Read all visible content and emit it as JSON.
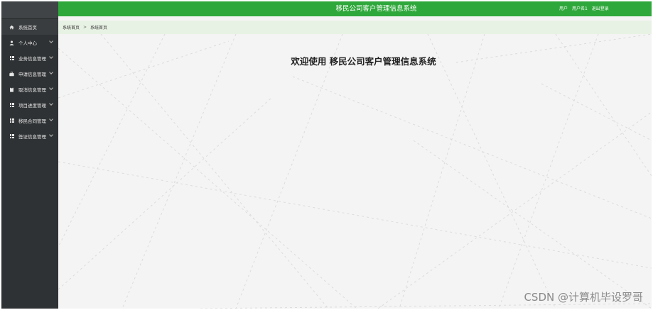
{
  "app_title": "移民公司客户管理信息系统",
  "header": {
    "user_label": "用户",
    "username": "用户名1",
    "logout_label": "退出登录"
  },
  "sidebar": {
    "items": [
      {
        "label": "系统首页",
        "icon": "home-icon",
        "active": true,
        "expandable": false
      },
      {
        "label": "个人中心",
        "icon": "user-icon",
        "active": false,
        "expandable": true
      },
      {
        "label": "业务信息管理",
        "icon": "grid-icon",
        "active": false,
        "expandable": true
      },
      {
        "label": "申请信息管理",
        "icon": "briefcase-icon",
        "active": false,
        "expandable": true
      },
      {
        "label": "取消信息管理",
        "icon": "clipboard-icon",
        "active": false,
        "expandable": true
      },
      {
        "label": "项目进度管理",
        "icon": "grid-icon",
        "active": false,
        "expandable": true
      },
      {
        "label": "移民合同管理",
        "icon": "grid-icon",
        "active": false,
        "expandable": true
      },
      {
        "label": "签证信息管理",
        "icon": "grid-icon",
        "active": false,
        "expandable": true
      }
    ]
  },
  "breadcrumb": {
    "items": [
      "系统首页",
      "系统首页"
    ],
    "separator": ">"
  },
  "main": {
    "welcome_text": "欢迎使用 移民公司客户管理信息系统"
  },
  "watermark": "CSDN @计算机毕设罗哥",
  "colors": {
    "header_green": "#2fa83b",
    "sidebar_dark": "#2f3234",
    "breadcrumb_bg": "#e8f2e4",
    "content_bg": "#f4f4f4"
  }
}
